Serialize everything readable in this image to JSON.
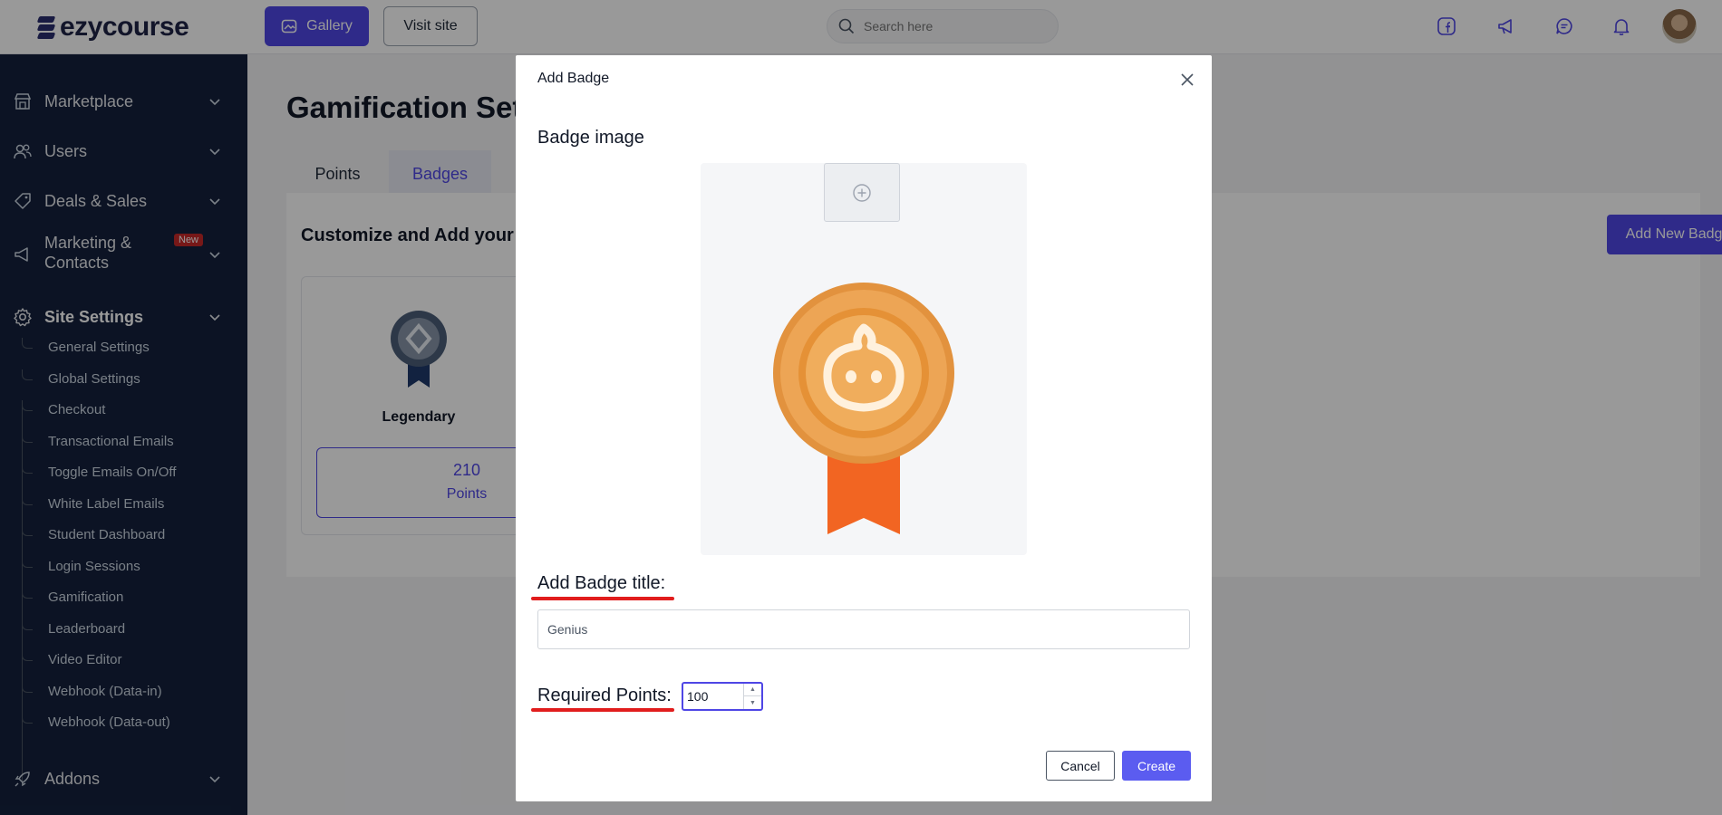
{
  "brand": {
    "name": "ezycourse"
  },
  "topbar": {
    "gallery_label": "Gallery",
    "visit_label": "Visit site",
    "search_placeholder": "Search here",
    "icons": [
      "facebook-icon",
      "megaphone-icon",
      "chat-icon",
      "bell-icon"
    ]
  },
  "sidebar": {
    "items": [
      {
        "label": "Marketplace",
        "icon": "store-icon"
      },
      {
        "label": "Users",
        "icon": "users-icon"
      },
      {
        "label": "Deals & Sales",
        "icon": "tag-icon"
      },
      {
        "label_line1": "Marketing &",
        "label_line2": "Contacts",
        "badge": "New",
        "icon": "megaphone-icon"
      },
      {
        "label": "Site Settings",
        "icon": "gear-icon"
      },
      {
        "label": "Addons",
        "icon": "rocket-icon"
      }
    ],
    "sub_items": [
      "General Settings",
      "Global Settings",
      "Checkout",
      "Transactional Emails",
      "Toggle Emails On/Off",
      "White Label Emails",
      "Student Dashboard",
      "Login Sessions",
      "Gamification",
      "Leaderboard",
      "Video Editor",
      "Webhook (Data-in)",
      "Webhook (Data-out)"
    ]
  },
  "main": {
    "title": "Gamification Sett",
    "tabs": [
      "Points",
      "Badges"
    ],
    "active_tab": "Badges",
    "panel_title": "Customize and Add your B",
    "add_new_label": "Add New Badge",
    "card": {
      "name": "Legendary",
      "points_value": "210",
      "points_label": "Points"
    }
  },
  "modal": {
    "title": "Add Badge",
    "image_label": "Badge image",
    "title_label": "Add Badge title:",
    "title_value": "Genius",
    "points_label": "Required Points:",
    "points_value": "100",
    "cancel_label": "Cancel",
    "create_label": "Create"
  },
  "colors": {
    "accent": "#4f46e5",
    "sidebar_bg": "#14213d",
    "highlight": "#e11d1d",
    "new_badge": "#c62828"
  }
}
